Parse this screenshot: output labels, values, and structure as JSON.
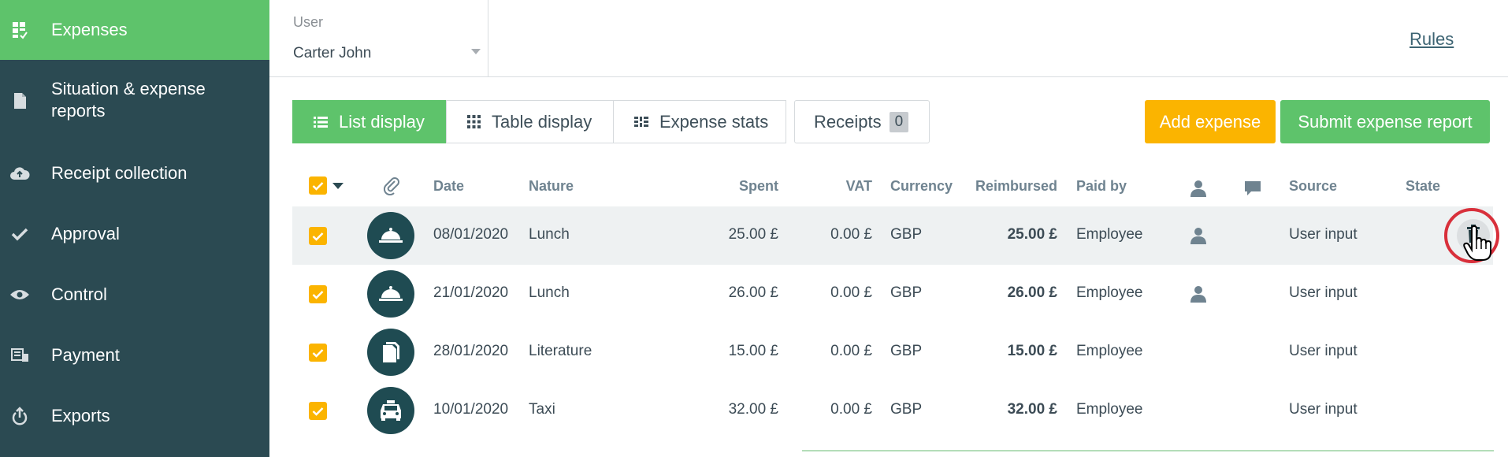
{
  "sidebar": {
    "items": [
      {
        "label": "Expenses",
        "icon": "expenses-grid-icon",
        "active": true
      },
      {
        "label": "Situation & expense reports",
        "icon": "document-icon"
      },
      {
        "label": "Receipt collection",
        "icon": "cloud-upload-icon"
      },
      {
        "label": "Approval",
        "icon": "checkmark-icon"
      },
      {
        "label": "Control",
        "icon": "eye-icon"
      },
      {
        "label": "Payment",
        "icon": "payment-icon"
      },
      {
        "label": "Exports",
        "icon": "export-icon"
      }
    ]
  },
  "header": {
    "user_caption": "User",
    "user_value": "Carter John",
    "rules_label": "Rules"
  },
  "toolbar": {
    "list_display": "List display",
    "table_display": "Table display",
    "expense_stats": "Expense stats",
    "receipts_label": "Receipts",
    "receipts_count": "0",
    "add_expense": "Add expense",
    "submit_report": "Submit expense report"
  },
  "table": {
    "columns": [
      "Date",
      "Nature",
      "Spent",
      "VAT",
      "Currency",
      "Reimbursed",
      "Paid by",
      "Source",
      "State"
    ],
    "rows": [
      {
        "date": "08/01/2020",
        "nature": "Lunch",
        "spent": "25.00 £",
        "vat": "0.00 £",
        "currency": "GBP",
        "reimbursed": "25.00 £",
        "paid_by": "Employee",
        "source": "User input",
        "icon": "meal-cloche-icon",
        "has_person": true
      },
      {
        "date": "21/01/2020",
        "nature": "Lunch",
        "spent": "26.00 £",
        "vat": "0.00 £",
        "currency": "GBP",
        "reimbursed": "26.00 £",
        "paid_by": "Employee",
        "source": "User input",
        "icon": "meal-cloche-icon",
        "has_person": true
      },
      {
        "date": "28/01/2020",
        "nature": "Literature",
        "spent": "15.00 £",
        "vat": "0.00 £",
        "currency": "GBP",
        "reimbursed": "15.00 £",
        "paid_by": "Employee",
        "source": "User input",
        "icon": "document-icon",
        "has_person": false
      },
      {
        "date": "10/01/2020",
        "nature": "Taxi",
        "spent": "32.00 £",
        "vat": "0.00 £",
        "currency": "GBP",
        "reimbursed": "32.00 £",
        "paid_by": "Employee",
        "source": "User input",
        "icon": "taxi-icon",
        "has_person": false
      }
    ]
  },
  "colors": {
    "sidebar_bg": "#2b4a52",
    "accent_green": "#5ec36b",
    "accent_yellow": "#fbb400",
    "avatar_bg": "#1f4b52",
    "highlight_red": "#d8303b"
  }
}
